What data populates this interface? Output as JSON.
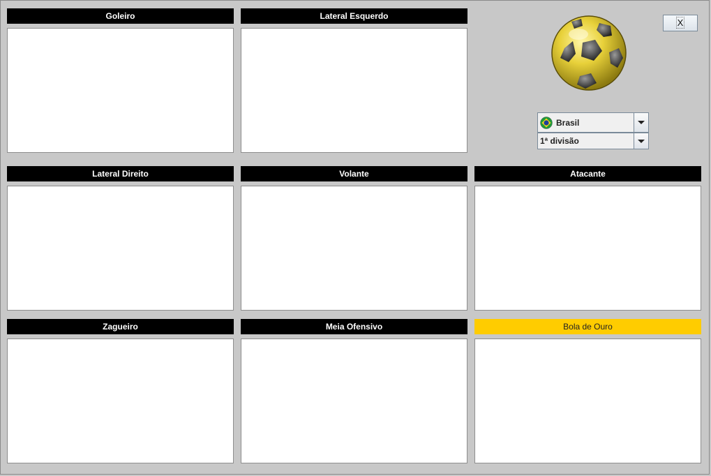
{
  "panels": [
    {
      "title": "Goleiro"
    },
    {
      "title": "Lateral Esquerdo"
    },
    {
      "title": "Lateral Direito"
    },
    {
      "title": "Volante"
    },
    {
      "title": "Atacante"
    },
    {
      "title": "Zagueiro"
    },
    {
      "title": "Meia Ofensivo"
    },
    {
      "title": "Bola de Ouro"
    }
  ],
  "close_button": {
    "label": "X"
  },
  "country_select": {
    "value": "Brasil",
    "icon": "brazil-flag-icon"
  },
  "division_select": {
    "value": "1ª divisão"
  },
  "logo": {
    "icon": "golden-soccer-ball-icon"
  },
  "colors": {
    "header": "#000000",
    "gold_header": "#ffcc00",
    "background": "#c8c8c8"
  }
}
